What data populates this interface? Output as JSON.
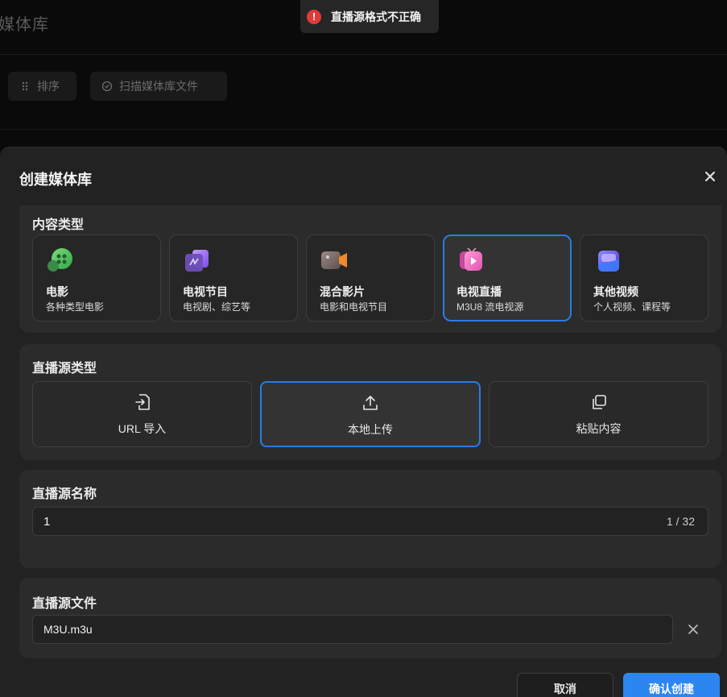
{
  "background": {
    "title": "媒体库",
    "sort_label": "排序",
    "scan_label": "扫描媒体库文件"
  },
  "toast": {
    "icon": "error-icon",
    "message": "直播源格式不正确",
    "color": "#e03a3a"
  },
  "modal": {
    "title": "创建媒体库",
    "close_icon": "close-icon",
    "content_type": {
      "title": "内容类型",
      "options": [
        {
          "name": "电影",
          "desc": "各种类型电影",
          "icon": "movie-icon",
          "active": false
        },
        {
          "name": "电视节目",
          "desc": "电视剧、综艺等",
          "icon": "tv-show-icon",
          "active": false
        },
        {
          "name": "混合影片",
          "desc": "电影和电视节目",
          "icon": "camera-icon",
          "active": false
        },
        {
          "name": "电视直播",
          "desc": "M3U8 流电视源",
          "icon": "live-tv-icon",
          "active": true
        },
        {
          "name": "其他视频",
          "desc": "个人视频、课程等",
          "icon": "folder-icon",
          "active": false
        }
      ]
    },
    "live_type": {
      "title": "直播源类型",
      "options": [
        {
          "label": "URL 导入",
          "icon": "file-import-icon",
          "active": false
        },
        {
          "label": "本地上传",
          "icon": "upload-icon",
          "active": true
        },
        {
          "label": "粘贴内容",
          "icon": "copy-icon",
          "active": false
        }
      ]
    },
    "live_name": {
      "title": "直播源名称",
      "value": "1",
      "counter": "1 / 32"
    },
    "live_file": {
      "title": "直播源文件",
      "value": "M3U.m3u"
    },
    "cancel_label": "取消",
    "confirm_label": "确认创建",
    "accent_color": "#2d85f0"
  }
}
